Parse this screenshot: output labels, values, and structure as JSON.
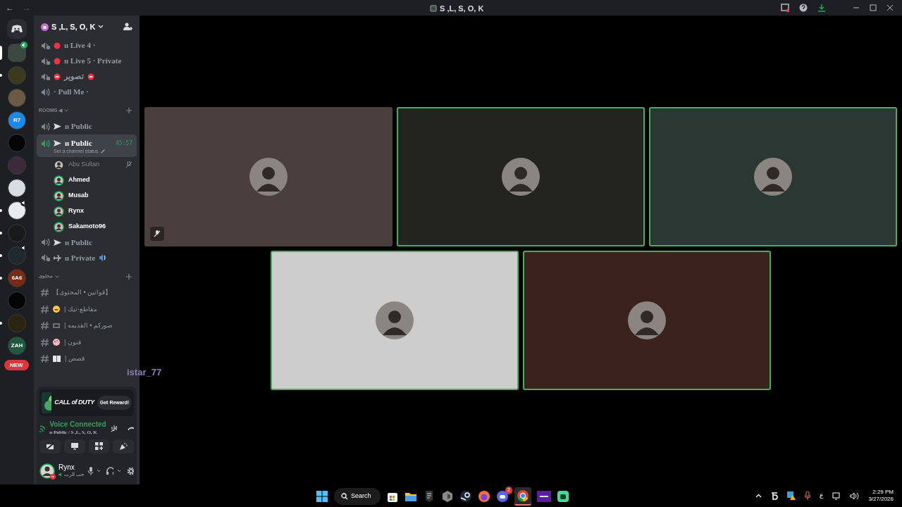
{
  "window": {
    "title": "S ,L, S, O, K",
    "back": "←",
    "forward": "→"
  },
  "servers": [
    {
      "color": "#3a4a3e",
      "unread": false,
      "selected": true,
      "voice": true
    },
    {
      "color": "#3b3a1e",
      "unread": true,
      "selected": false,
      "voice": false
    },
    {
      "color": "#6b5a44",
      "unread": false,
      "selected": false,
      "voice": false
    },
    {
      "color": "#1e88e5",
      "unread": false,
      "selected": false,
      "voice": false,
      "label": "R7"
    },
    {
      "color": "#050505",
      "unread": false,
      "selected": false,
      "voice": false
    },
    {
      "color": "#3a2a3a",
      "unread": false,
      "selected": false,
      "voice": false
    },
    {
      "color": "#d8dde3",
      "unread": false,
      "selected": false,
      "voice": false
    },
    {
      "color": "#e8ecef",
      "unread": true,
      "selected": false,
      "voice": true
    },
    {
      "color": "#1a1a1a",
      "unread": true,
      "selected": false,
      "voice": false
    },
    {
      "color": "#202a2a",
      "unread": true,
      "selected": false,
      "voice": true
    },
    {
      "color": "#7a2a10",
      "unread": true,
      "selected": false,
      "voice": false,
      "label": "6A6"
    },
    {
      "color": "#050505",
      "unread": false,
      "selected": false,
      "voice": false
    },
    {
      "color": "#2a2410",
      "unread": true,
      "selected": false,
      "voice": false
    },
    {
      "color": "#1f5a40",
      "unread": false,
      "selected": false,
      "voice": false,
      "label": "ZAH"
    }
  ],
  "new_badge": "NEW",
  "server_name": "S ,L, S, O, K",
  "channels": [
    {
      "kind": "voice",
      "locked": true,
      "prefix": {
        "kind": "dot"
      },
      "name": "ıı Live 4 ·",
      "selected": false
    },
    {
      "kind": "voice",
      "locked": true,
      "prefix": {
        "kind": "dot"
      },
      "name": "ıı Live 5 · Private",
      "selected": false
    },
    {
      "kind": "voice",
      "locked": true,
      "prefix": {
        "kind": "no-entry"
      },
      "name": "تصوير",
      "selected": false
    },
    {
      "kind": "voice",
      "locked": false,
      "name": "· Pull Me ·",
      "selected": false
    },
    {
      "kind": "category",
      "name": "ROOMS ◀"
    },
    {
      "kind": "voice",
      "locked": false,
      "prefix": {
        "kind": "arrow"
      },
      "name": "ıı Public",
      "selected": false
    },
    {
      "kind": "voice",
      "locked": false,
      "prefix": {
        "kind": "arrow"
      },
      "name": "ıı Public",
      "selected": true,
      "timer": "45:57",
      "status": "Set a channel status",
      "members": [
        {
          "name": "Abu Sultan",
          "speaking": false,
          "muted": true
        },
        {
          "name": "Ahmed",
          "speaking": true,
          "muted": false
        },
        {
          "name": "Musab",
          "speaking": true,
          "muted": false
        },
        {
          "name": "Rynx",
          "speaking": true,
          "muted": false
        },
        {
          "name": "Sakamoto96",
          "speaking": true,
          "muted": false
        }
      ]
    },
    {
      "kind": "voice",
      "locked": false,
      "prefix": {
        "kind": "arrow"
      },
      "name": "ıı Public",
      "selected": false
    },
    {
      "kind": "voice",
      "locked": true,
      "prefix": {
        "kind": "plane"
      },
      "name": "ıı Private",
      "speaker": true,
      "selected": false
    },
    {
      "kind": "category",
      "name": "محتوى"
    },
    {
      "kind": "text",
      "name": "【قوانين • المحتوى】"
    },
    {
      "kind": "text",
      "emoji": {
        "kind": "laugh"
      },
      "name": "| مقاطع-تيك"
    },
    {
      "kind": "text",
      "emoji": {
        "kind": "film"
      },
      "name": "| صوركم • القديمه"
    },
    {
      "kind": "text",
      "emoji": {
        "kind": "palette"
      },
      "name": "| فنون"
    },
    {
      "kind": "text",
      "emoji": {
        "kind": "book"
      },
      "name": "| قصص"
    }
  ],
  "overlay_name": "istar_77",
  "promo": {
    "title": "CALL of DUTY",
    "button": "Get Reward!"
  },
  "voice": {
    "title": "Voice Connected",
    "channel": "ıı Public / S ,L, S, O, K"
  },
  "user": {
    "name": "Rynx",
    "status": "حب الرب"
  },
  "tiles": [
    {
      "color": "#4a3f3c",
      "speaking": false,
      "muted": true
    },
    {
      "color": "#23241d",
      "speaking": true,
      "muted": false
    },
    {
      "color": "#2a3733",
      "speaking": true,
      "muted": false
    },
    {
      "color": "#cdcdcd",
      "speaking": true,
      "muted": false
    },
    {
      "color": "#3a221e",
      "speaking": true,
      "muted": false
    }
  ],
  "taskbar": {
    "search": "Search",
    "time": "2:29 PM",
    "date": "3/27/2026",
    "discord_badge": "2",
    "lang": "ع"
  }
}
